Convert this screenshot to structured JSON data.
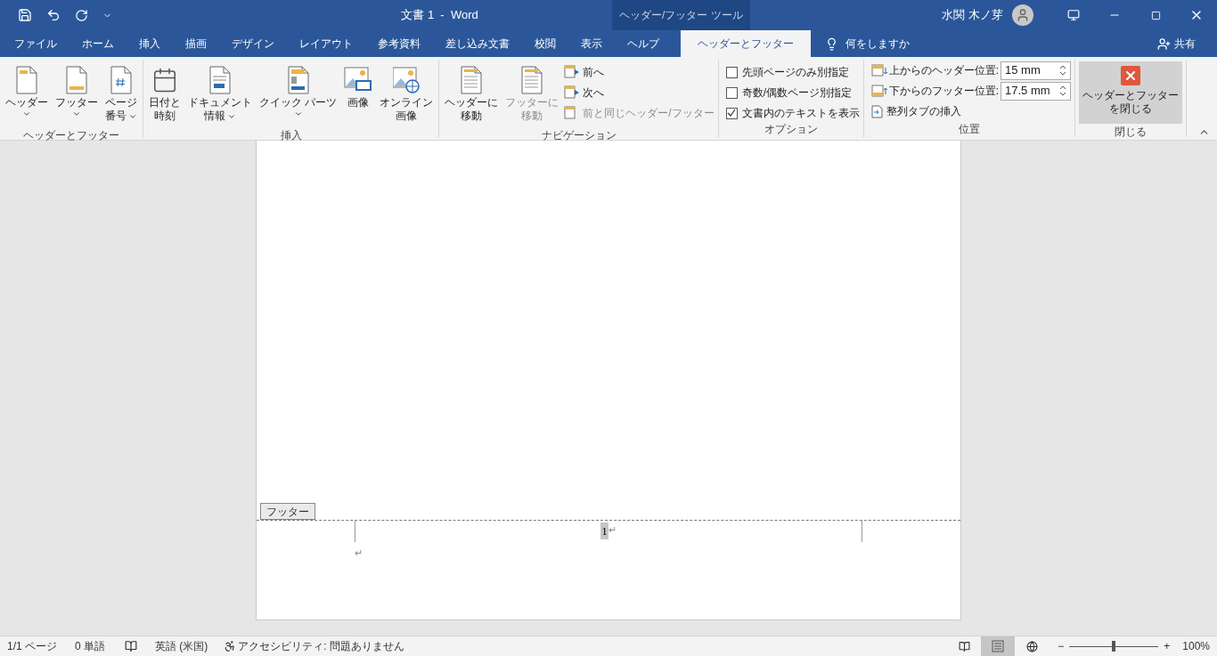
{
  "title_bar": {
    "title": "文書 1  -  Word",
    "context_label": "ヘッダー/フッター ツール",
    "user": "水関 木ノ芽"
  },
  "tabs": [
    {
      "label": "ファイル",
      "selected": false
    },
    {
      "label": "ホーム",
      "selected": false
    },
    {
      "label": "挿入",
      "selected": false
    },
    {
      "label": "描画",
      "selected": false
    },
    {
      "label": "デザイン",
      "selected": false
    },
    {
      "label": "レイアウト",
      "selected": false
    },
    {
      "label": "参考資料",
      "selected": false
    },
    {
      "label": "差し込み文書",
      "selected": false
    },
    {
      "label": "校閲",
      "selected": false
    },
    {
      "label": "表示",
      "selected": false
    },
    {
      "label": "ヘルプ",
      "selected": false
    },
    {
      "label": "ヘッダーとフッター",
      "selected": true
    }
  ],
  "tell_me": {
    "placeholder": "何をしますか"
  },
  "share": "共有",
  "ribbon_groups": [
    {
      "name": "ヘッダーとフッター",
      "items": [
        {
          "kind": "large",
          "lines": [
            "ヘッダー"
          ],
          "dropdown": true,
          "disabled": false
        },
        {
          "kind": "large",
          "lines": [
            "フッター"
          ],
          "dropdown": true,
          "disabled": false
        },
        {
          "kind": "large",
          "lines": [
            "ページ",
            "番号"
          ],
          "dropdown": true,
          "disabled": false
        }
      ]
    },
    {
      "name": "挿入",
      "items": [
        {
          "kind": "large",
          "lines": [
            "日付と",
            "時刻"
          ],
          "dropdown": false,
          "disabled": false
        },
        {
          "kind": "large",
          "lines": [
            "ドキュメント",
            "情報"
          ],
          "dropdown": true,
          "disabled": false
        },
        {
          "kind": "large",
          "lines": [
            "クイック パーツ"
          ],
          "dropdown": true,
          "disabled": false
        },
        {
          "kind": "large",
          "lines": [
            "画像"
          ],
          "dropdown": false,
          "disabled": false
        },
        {
          "kind": "large",
          "lines": [
            "オンライン",
            "画像"
          ],
          "dropdown": false,
          "disabled": false
        }
      ]
    },
    {
      "name": "ナビゲーション",
      "items": [
        {
          "kind": "large",
          "lines": [
            "ヘッダーに",
            "移動"
          ],
          "dropdown": false,
          "disabled": false
        },
        {
          "kind": "large",
          "lines": [
            "フッターに",
            "移動"
          ],
          "dropdown": false,
          "disabled": true
        },
        {
          "kind": "stack",
          "items": [
            {
              "label": "前へ",
              "disabled": false
            },
            {
              "label": "次へ",
              "disabled": false
            },
            {
              "label": "前と同じヘッダー/フッター",
              "disabled": true
            }
          ]
        }
      ]
    },
    {
      "name": "オプション",
      "items": [
        {
          "kind": "checks",
          "items": [
            {
              "label": "先頭ページのみ別指定",
              "checked": false
            },
            {
              "label": "奇数/偶数ページ別指定",
              "checked": false
            },
            {
              "label": "文書内のテキストを表示",
              "checked": true
            }
          ]
        }
      ]
    },
    {
      "name": "位置",
      "items": [
        {
          "kind": "position",
          "rows": [
            {
              "kind": "spin",
              "label": "上からのヘッダー位置:",
              "value": "15 mm"
            },
            {
              "kind": "spin",
              "label": "下からのフッター位置:",
              "value": "17.5 mm"
            },
            {
              "kind": "button",
              "label": "整列タブの挿入"
            }
          ]
        }
      ]
    },
    {
      "name": "閉じる",
      "items": [
        {
          "kind": "close",
          "lines": [
            "ヘッダーとフッター",
            "を閉じる"
          ]
        }
      ]
    }
  ],
  "document": {
    "footer_tag": "フッター",
    "page_number": "1",
    "paragraph_mark": "↵",
    "empty_mark": "↵"
  },
  "status_bar": {
    "page": "1/1 ページ",
    "words": "0 単語",
    "language": "英語 (米国)",
    "accessibility": "アクセシビリティ: 問題ありません",
    "views": [
      {
        "kind": "read",
        "selected": false
      },
      {
        "kind": "print",
        "selected": true
      },
      {
        "kind": "web",
        "selected": false
      }
    ],
    "zoom_minus": "−",
    "zoom_plus": "+",
    "zoom": {
      "level": 0.5
    },
    "zoom_label": "100%"
  }
}
